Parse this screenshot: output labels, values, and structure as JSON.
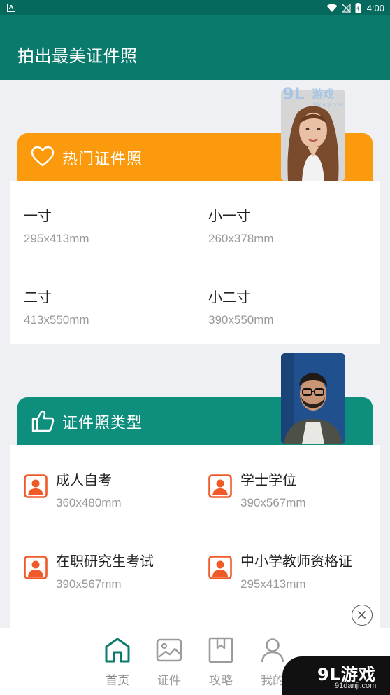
{
  "status_bar": {
    "time": "4:00",
    "app_badge": "A"
  },
  "app_bar": {
    "title": "拍出最美证件照"
  },
  "hot_section": {
    "title": "热门证件照",
    "items": [
      {
        "title": "一寸",
        "size": "295x413mm"
      },
      {
        "title": "小一寸",
        "size": "260x378mm"
      },
      {
        "title": "二寸",
        "size": "413x550mm"
      },
      {
        "title": "小二寸",
        "size": "390x550mm"
      }
    ]
  },
  "types_section": {
    "title": "证件照类型",
    "items": [
      {
        "title": "成人自考",
        "size": "360x480mm"
      },
      {
        "title": "学士学位",
        "size": "390x567mm"
      },
      {
        "title": "在职研究生考试",
        "size": "390x567mm"
      },
      {
        "title": "中小学教师资格证",
        "size": "295x413mm"
      }
    ]
  },
  "bottom_nav": {
    "items": [
      {
        "label": "首页",
        "icon": "home-icon"
      },
      {
        "label": "证件",
        "icon": "image-icon"
      },
      {
        "label": "攻略",
        "icon": "book-icon"
      },
      {
        "label": "我的",
        "icon": "user-icon"
      }
    ],
    "active": "首页"
  },
  "watermark": {
    "brand": "9L游戏",
    "site": "91danji.com"
  },
  "colors": {
    "primary": "#0a7a6c",
    "hot_header": "#fb9a0c",
    "types_header": "#0e8f7e",
    "doc_icon": "#f05a28"
  }
}
